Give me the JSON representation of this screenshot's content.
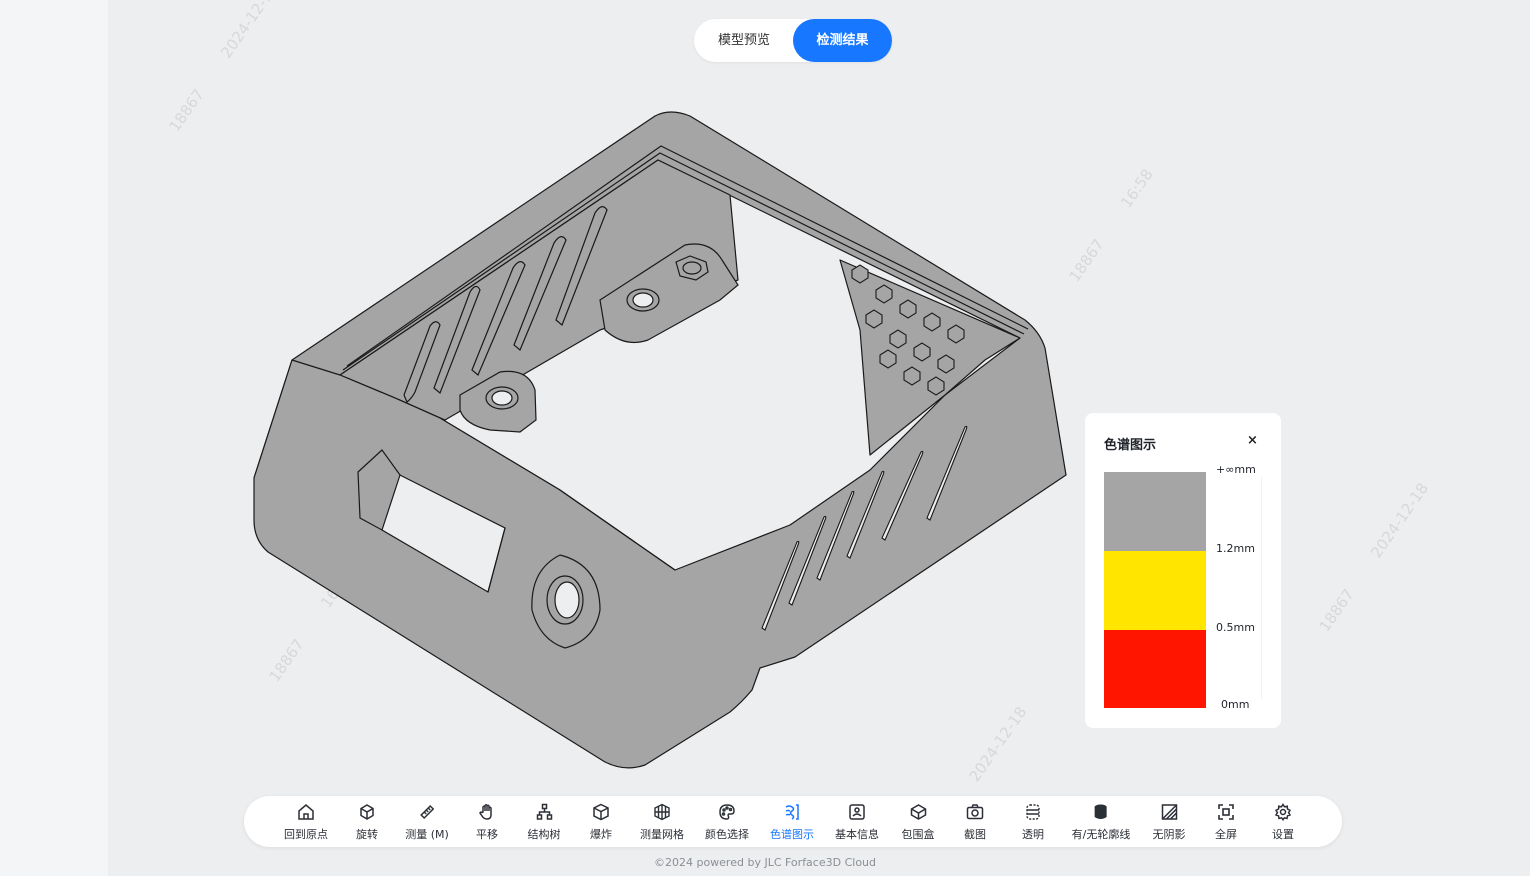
{
  "view_tabs": {
    "preview": "模型预览",
    "result": "检测结果"
  },
  "legend": {
    "title": "色谱图示",
    "close": "×",
    "labels": [
      "+∞mm",
      "1.2mm",
      "0.5mm",
      "0mm"
    ],
    "bands": [
      {
        "color": "#a5a5a5"
      },
      {
        "color": "#ffe500"
      },
      {
        "color": "#ff1500"
      }
    ]
  },
  "toolbar": {
    "home": "回到原点",
    "rotate": "旋转",
    "measure": "测量 (M)",
    "pan": "平移",
    "tree": "结构树",
    "explode": "爆炸",
    "mesh": "测量网格",
    "color_select": "颜色选择",
    "spectrum": "色谱图示",
    "info": "基本信息",
    "bbox": "包围盒",
    "screenshot": "截图",
    "transparent": "透明",
    "outline": "有/无轮廓线",
    "no_shadow": "无阴影",
    "fullscreen": "全屏",
    "settings": "设置"
  },
  "footer": "©2024 powered by JLC Forface3D Cloud",
  "colors": {
    "accent": "#1877ff",
    "model": "#a5a5a5",
    "background": "#edeef0"
  }
}
